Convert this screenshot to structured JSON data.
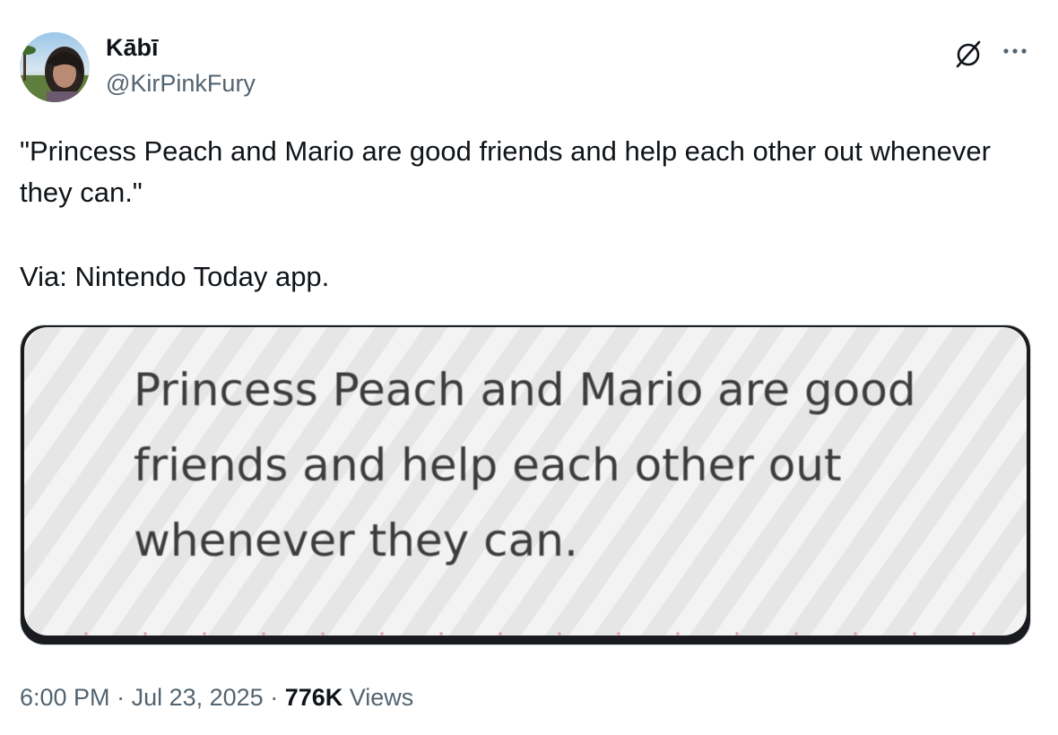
{
  "author": {
    "display_name": "Kābī",
    "handle": "@KirPinkFury"
  },
  "tweet": {
    "text_line_1": "\"Princess Peach and Mario are good friends and help each other out whenever they can.\"",
    "text_line_2": "Via: Nintendo Today app."
  },
  "media": {
    "caption_text": "Princess Peach and Mario are good friends and help each other out whenever they can."
  },
  "meta": {
    "time": "6:00 PM",
    "separator_1": " · ",
    "date": "Jul 23, 2025",
    "separator_2": " · ",
    "views_count": "776K",
    "views_label": " Views"
  },
  "icons": {
    "grok": "grok-icon",
    "more": "more-options-icon"
  },
  "colors": {
    "text_primary": "#0f1419",
    "text_secondary": "#536471",
    "border": "#cfd9de"
  }
}
